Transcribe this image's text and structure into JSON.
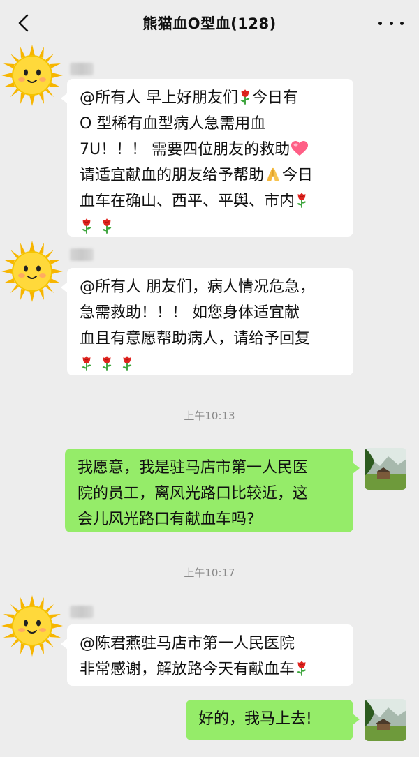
{
  "header": {
    "title": "熊猫血O型血(128)"
  },
  "messages": [
    {
      "segments": [
        "@所有人  早上好朋友们",
        "今日有",
        "O 型稀有血型病人急需用血",
        "7U！！！ 需要四位朋友的救助",
        "请适宜献血的朋友给予帮助",
        "今日",
        "血车在确山、西平、平舆、市内"
      ],
      "emoji": [
        "rose-icon",
        "heart-icon",
        "pray-icon",
        "rose-icon",
        "rose-icon",
        "rose-icon"
      ]
    },
    {
      "lines": [
        "@所有人  朋友们，病人情况危急，",
        "急需救助！！！ 如您身体适宜献",
        "血且有意愿帮助病人，请给予回复"
      ],
      "emoji": [
        "rose-icon",
        "rose-icon",
        "rose-icon"
      ]
    },
    {
      "lines": [
        "我愿意，我是驻马店市第一人民医",
        "院的员工，离风光路口比较近，这",
        "会儿风光路口有献血车吗?"
      ]
    },
    {
      "lines": [
        "@陈君燕驻马店市第一人民医院",
        "非常感谢，解放路今天有献血车"
      ],
      "emoji": [
        "rose-icon"
      ]
    },
    {
      "lines": [
        "好的，我马上去!"
      ]
    }
  ],
  "timestamps": [
    "上午10:13",
    "上午10:17"
  ],
  "colors": {
    "background": "#ededed",
    "incoming_bubble": "#ffffff",
    "outgoing_bubble": "#95ec69"
  }
}
